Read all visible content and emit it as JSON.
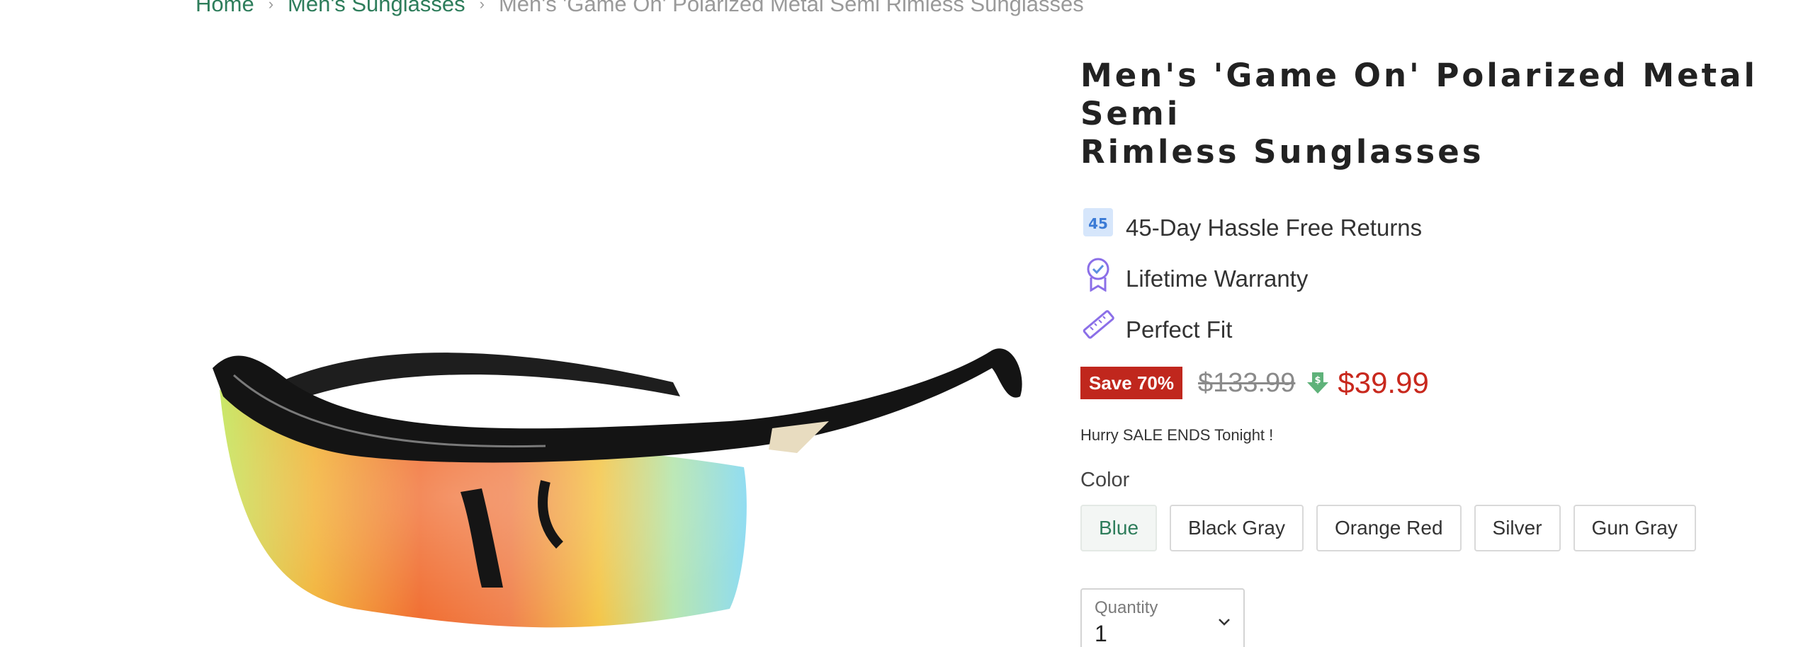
{
  "breadcrumb": {
    "home": "Home",
    "category": "Men's Sunglasses",
    "current": "Men's 'Game On' Polarized Metal Semi Rimless Sunglasses"
  },
  "product": {
    "title_line1": "Men's 'Game On' Polarized Metal Semi",
    "title_line2": "Rimless Sunglasses",
    "features": [
      {
        "icon": "returns-45-icon",
        "badge_text": "45",
        "label": "45-Day Hassle Free Returns"
      },
      {
        "icon": "warranty-ribbon-icon",
        "label": "Lifetime Warranty"
      },
      {
        "icon": "ruler-icon",
        "label": "Perfect Fit"
      }
    ],
    "save_badge": "Save 70%",
    "old_price": "$133.99",
    "new_price": "$39.99",
    "price_drop_icon": "price-drop-icon",
    "urgency": "Hurry SALE ENDS Tonight !",
    "color_label": "Color",
    "colors": [
      "Blue",
      "Black Gray",
      "Orange Red",
      "Silver",
      "Gun Gray"
    ],
    "selected_color": "Blue",
    "quantity_label": "Quantity",
    "quantity_value": "1"
  },
  "colors": {
    "link_green": "#2e7d5b",
    "sale_red": "#c0271d",
    "price_red": "#c8281d"
  }
}
